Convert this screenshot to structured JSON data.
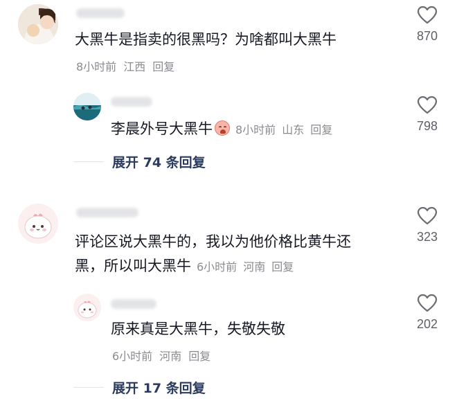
{
  "comments": [
    {
      "text": "大黑牛是指卖的很黑吗？为啥都叫大黑牛",
      "time": "8小时前",
      "location": "江西",
      "reply_label": "回复",
      "likes": "870",
      "replies": [
        {
          "text": "李晨外号大黑牛",
          "time": "8小时前",
          "location": "山东",
          "reply_label": "回复",
          "likes": "798"
        }
      ],
      "expand_label": "展开 74 条回复"
    },
    {
      "text_line1": "评论区说大黑牛的，我以为他价格比黄牛还",
      "text_line2": "黑，所以叫大黑牛",
      "time": "6小时前",
      "location": "河南",
      "reply_label": "回复",
      "likes": "323",
      "replies": [
        {
          "text": "原来真是大黑牛，失敬失敬",
          "time": "6小时前",
          "location": "河南",
          "reply_label": "回复",
          "likes": "202"
        }
      ],
      "expand_label": "展开 17 条回复"
    }
  ],
  "icons": {
    "like": "heart-outline-icon",
    "emoji": "crying-face-emoji-icon"
  },
  "colors": {
    "text": "#161823",
    "meta": "#8a8b91",
    "expand": "#2a3b5e"
  }
}
